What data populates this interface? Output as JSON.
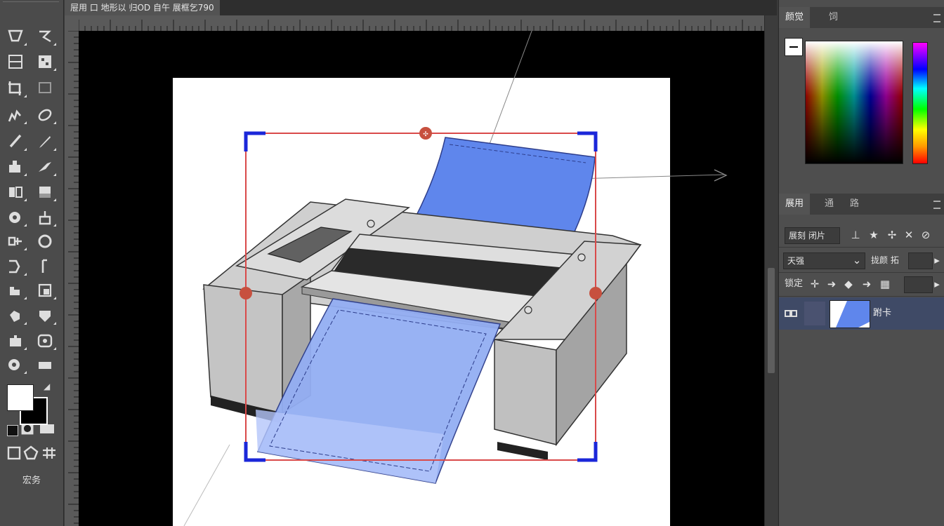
{
  "document": {
    "tab_title": "屉用 口 地形以 归OD 自午 展框乞790"
  },
  "toolbar": {
    "bottom_label": "宏务"
  },
  "colors": {
    "accent": "#2a2fd9",
    "transform_box": "#d94a4a",
    "paper_blue": "#6f8ff0",
    "layer_selected": "#3f4a66"
  },
  "panels": {
    "color": {
      "tabs": [
        "颜觉",
        "饲"
      ]
    },
    "layers": {
      "tabs": [
        "展用",
        "通",
        "路"
      ],
      "search_label": "展刻 闭片",
      "blend_mode": "天强",
      "opacity_label": "拢颜 拓",
      "lock_label": "锁定",
      "layer_name": "跗卡"
    }
  },
  "icons": [
    "marquee-icon",
    "lasso-icon",
    "crop-icon",
    "eyedropper-icon",
    "healing-icon",
    "brush-icon",
    "stamp-icon",
    "history-brush-icon",
    "eraser-icon",
    "gradient-icon",
    "blur-icon",
    "dodge-icon",
    "pen-icon",
    "type-icon",
    "path-select-icon",
    "shape-icon",
    "hand-icon",
    "zoom-icon",
    "eye-icon",
    "link-icon"
  ]
}
